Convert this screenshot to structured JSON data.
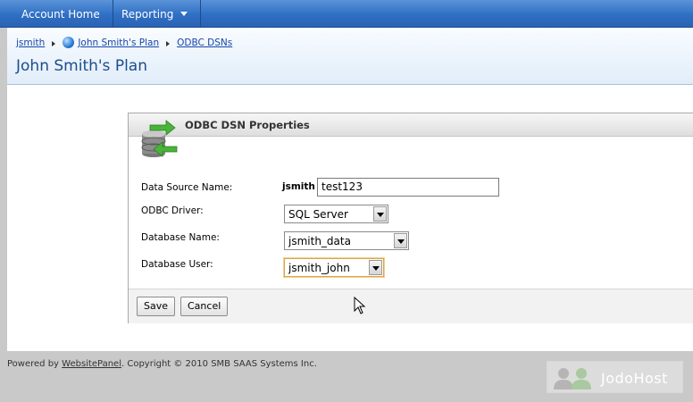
{
  "topnav": {
    "items": [
      {
        "label": "Account Home"
      },
      {
        "label": "Reporting"
      }
    ]
  },
  "breadcrumb": {
    "items": [
      "jsmith",
      "John Smith's Plan",
      "ODBC DSNs"
    ]
  },
  "page_title": "John Smith's Plan",
  "dialog": {
    "title": "ODBC DSN Properties",
    "fields": {
      "dsn_label": "Data Source Name:",
      "dsn_prefix": "jsmith",
      "dsn_value": "test123",
      "driver_label": "ODBC Driver:",
      "driver_value": "SQL Server",
      "dbname_label": "Database Name:",
      "dbname_value": "jsmith_data",
      "dbuser_label": "Database User:",
      "dbuser_value": "jsmith_john"
    },
    "buttons": {
      "save": "Save",
      "cancel": "Cancel"
    }
  },
  "footer": {
    "powered": "Powered by ",
    "link": "WebsitePanel",
    "rest": ". Copyright © 2010 SMB SAAS Systems Inc.",
    "brand": "JodoHost"
  },
  "colors": {
    "nav": "#2f6fc4",
    "title": "#1c4d8c",
    "link": "#1646a8"
  }
}
